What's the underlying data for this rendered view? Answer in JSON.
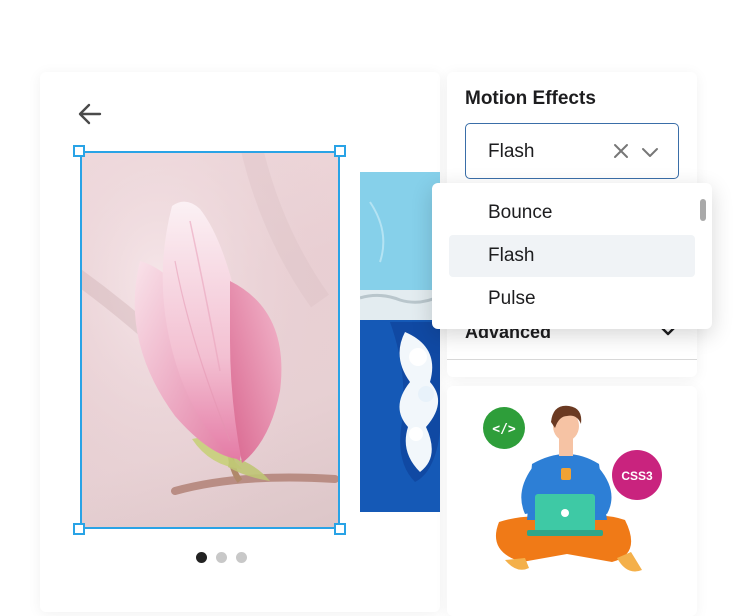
{
  "motion_panel": {
    "title": "Motion Effects",
    "selected_value": "Flash",
    "options": [
      "Bounce",
      "Flash",
      "Pulse"
    ],
    "selected_index": 1
  },
  "advanced_section": {
    "label": "Advanced"
  },
  "carousel": {
    "active_slide": 1,
    "total_slides": 3
  },
  "illustration": {
    "badge_html": "</>",
    "badge_css": "CSS3"
  },
  "colors": {
    "selection_blue": "#29a3e6",
    "select_border": "#3a6ea8",
    "badge_green": "#2e9e3a",
    "badge_magenta": "#c9237e",
    "shirt_blue": "#2d7fd6",
    "pants_orange": "#f07a17",
    "laptop_green": "#3ec9a5"
  }
}
